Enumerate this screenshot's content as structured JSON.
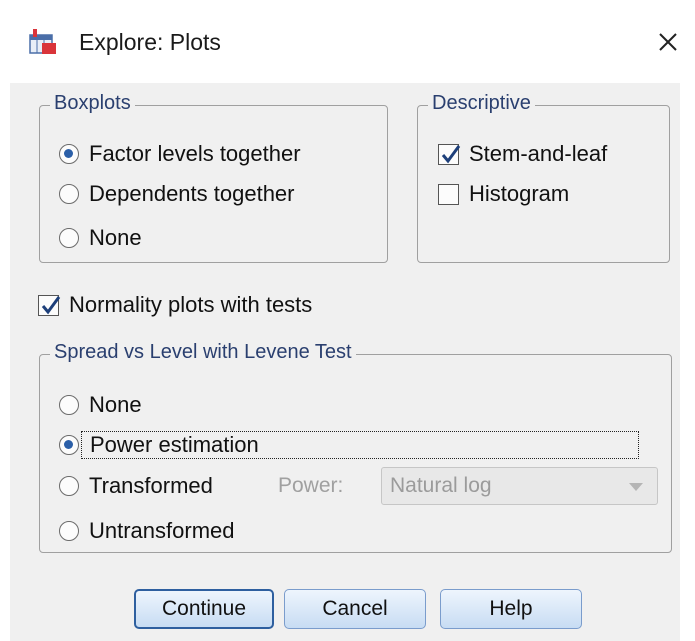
{
  "window": {
    "title": "Explore: Plots",
    "app_icon": "spss-table-icon",
    "close_icon": "close-x-icon"
  },
  "boxplots": {
    "legend": "Boxplots",
    "options": [
      {
        "label": "Factor levels together",
        "selected": true
      },
      {
        "label": "Dependents together",
        "selected": false
      },
      {
        "label": "None",
        "selected": false
      }
    ]
  },
  "descriptive": {
    "legend": "Descriptive",
    "options": [
      {
        "label": "Stem-and-leaf",
        "checked": true
      },
      {
        "label": "Histogram",
        "checked": false
      }
    ]
  },
  "normality": {
    "label": "Normality plots with tests",
    "checked": true
  },
  "spread": {
    "legend": "Spread vs Level with Levene Test",
    "options": [
      {
        "label": "None",
        "selected": false
      },
      {
        "label": "Power estimation",
        "selected": true
      },
      {
        "label": "Transformed",
        "selected": false
      },
      {
        "label": "Untransformed",
        "selected": false
      }
    ],
    "power_label": "Power:",
    "power_value": "Natural log"
  },
  "buttons": {
    "continue": "Continue",
    "cancel": "Cancel",
    "help": "Help"
  },
  "colors": {
    "accent": "#2b5fa8",
    "legend_text": "#2a3f6f",
    "dialog_bg": "#f0f0f0"
  }
}
